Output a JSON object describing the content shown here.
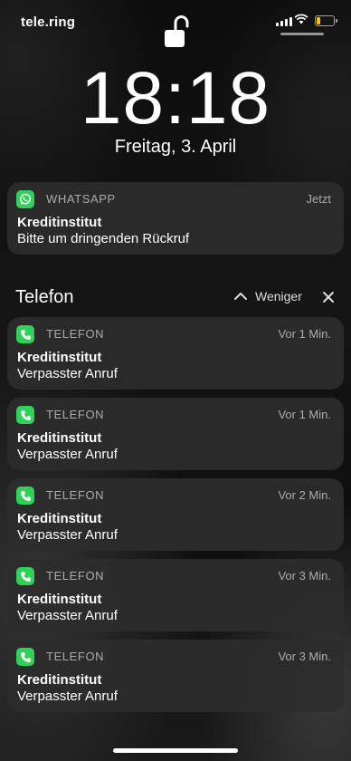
{
  "status_bar": {
    "carrier": "tele.ring",
    "battery_level": 0.25,
    "battery_color": "#f5c400"
  },
  "lock": {
    "icon": "lock-open-icon"
  },
  "clock": {
    "time": "18:18",
    "date": "Freitag, 3. April"
  },
  "whatsapp_notification": {
    "app": "WHATSAPP",
    "time": "Jetzt",
    "title": "Kreditinstitut",
    "body": "Bitte um dringenden Rückruf",
    "icon": "whatsapp-icon",
    "accent": "#2fd158"
  },
  "phone_group": {
    "title": "Telefon",
    "less_label": "Weniger",
    "notifications": [
      {
        "app": "TELEFON",
        "time": "Vor 1 Min.",
        "title": "Kreditinstitut",
        "body": "Verpasster Anruf"
      },
      {
        "app": "TELEFON",
        "time": "Vor 1 Min.",
        "title": "Kreditinstitut",
        "body": "Verpasster Anruf"
      },
      {
        "app": "TELEFON",
        "time": "Vor 2 Min.",
        "title": "Kreditinstitut",
        "body": "Verpasster Anruf"
      },
      {
        "app": "TELEFON",
        "time": "Vor 3 Min.",
        "title": "Kreditinstitut",
        "body": "Verpasster Anruf"
      },
      {
        "app": "TELEFON",
        "time": "Vor 3 Min.",
        "title": "Kreditinstitut",
        "body": "Verpasster Anruf"
      }
    ]
  }
}
